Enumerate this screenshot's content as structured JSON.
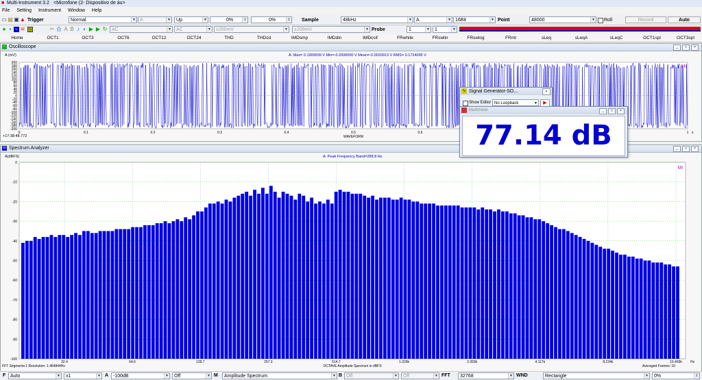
{
  "window": {
    "title": "Multi-Instrument 3.2",
    "device": "<Microfone (2- Dispositivo de áu>"
  },
  "menu": [
    "File",
    "Setting",
    "Instrument",
    "Window",
    "Help"
  ],
  "toolbar1": {
    "trigger_label": "Trigger",
    "trigger_mode": "Normal",
    "channel": "A",
    "edge": "Up",
    "level1": "0%",
    "level2": "0%",
    "sample_label": "Sample",
    "sample_rate": "48kHz",
    "chan2": "A",
    "bits": "16Bit",
    "point_label": "Point",
    "points": "48000",
    "roll_label": "Roll",
    "record_label": "Record",
    "auto_label": "Auto"
  },
  "toolbar2": {
    "coupling_a": "AC",
    "coupling_b": "AC",
    "range_a": "±200mV",
    "range_b": "±200mV",
    "probe_label": "Probe",
    "probe_a": "1",
    "probe_b": "1"
  },
  "tabs": [
    "Home",
    "OCT1",
    "OCT3",
    "OCT6",
    "OCT12",
    "OCT24",
    "THD",
    "THDcd",
    "IMDsmp",
    "IMDdin",
    "IMDccif",
    "FRwhite",
    "FRswlin",
    "FRswlog",
    "FRmt",
    "sLeq",
    "sLeqA",
    "sLeqC",
    "OCT1spl",
    "OCT3spl"
  ],
  "oscilloscope": {
    "title": "Oscilloscope",
    "unit_label": "A (mV)",
    "stats": "A: Max= 0.1999939 V  Min=-0.2000000 V  Mean=-0.0020913 V  RMS= 0.1724095 V",
    "y_ticks": [
      "200",
      "180",
      "160",
      "140",
      "120",
      "100",
      "80",
      "60",
      "40",
      "20",
      "0",
      "-20",
      "-40",
      "-60",
      "-80",
      "-100",
      "-120",
      "-140",
      "-160",
      "-180",
      "-200"
    ],
    "x_ticks": [
      "0",
      "0.1",
      "0.2",
      "0.3",
      "0.4",
      "0.5",
      "0.6",
      "0.7",
      "0.8",
      "0.9",
      "1"
    ],
    "x_unit": "s",
    "timestamp": "+17:38:48.772",
    "xlabel": "WAVEFORM",
    "marker": "Mi"
  },
  "siggen": {
    "title": "Signal Generator-SO...",
    "show_editor": "Show Editor",
    "loopback": "No Loopback"
  },
  "meter": {
    "title": "Multimeter",
    "value": "77.14 dB"
  },
  "spectrum": {
    "title": "Spectrum Analyzer",
    "unit_label": "A(dBFS)",
    "peak": "A: Peak Frequency Band=288.8 Hz",
    "marker": "Mi",
    "footer_left": "FFT  Segments:1    Resolution: 1.464844Hz",
    "footer_right": "Averaged Frames: 10",
    "xlabel": "OCTAVE Amplitude Spectrum in dBFS",
    "x_unit": "Hz"
  },
  "chart_data": {
    "type": "bar",
    "title": "",
    "xlabel": "OCTAVE Amplitude Spectrum in dBFS",
    "ylabel": "A(dBFS)",
    "ylim": [
      -100,
      0
    ],
    "y_ticks": [
      "0",
      "-10",
      "-20",
      "-30",
      "-40",
      "-50",
      "-60",
      "-70",
      "-80",
      "-90",
      "-100"
    ],
    "x_ticks": [
      "32.4",
      "64.6",
      "128.7",
      "257.3",
      "514.7",
      "1.029k",
      "2.059k",
      "4.117k",
      "8.234k",
      "16.469k"
    ],
    "values": [
      -41,
      -40,
      -40,
      -38,
      -39,
      -38,
      -38,
      -37,
      -38,
      -37,
      -37,
      -38,
      -37,
      -36,
      -37,
      -35,
      -35,
      -36,
      -36,
      -35,
      -35,
      -35,
      -35,
      -34,
      -34,
      -34,
      -34,
      -33,
      -33,
      -33,
      -32,
      -32,
      -32,
      -31,
      -31,
      -30,
      -31,
      -30,
      -29,
      -30,
      -28,
      -29,
      -27,
      -25,
      -25,
      -23,
      -21,
      -21,
      -20,
      -21,
      -19,
      -20,
      -18,
      -17,
      -16,
      -15,
      -17,
      -14,
      -16,
      -13,
      -16,
      -12,
      -15,
      -18,
      -15,
      -16,
      -17,
      -19,
      -16,
      -17,
      -20,
      -18,
      -21,
      -20,
      -21,
      -19,
      -21,
      -15,
      -14,
      -15,
      -15,
      -16,
      -16,
      -16,
      -17,
      -18,
      -17,
      -19,
      -18,
      -18,
      -18,
      -19,
      -19,
      -18,
      -19,
      -19,
      -20,
      -20,
      -21,
      -21,
      -21,
      -21,
      -22,
      -22,
      -22,
      -22,
      -22,
      -22,
      -23,
      -23,
      -23,
      -23,
      -24,
      -23,
      -24,
      -24,
      -25,
      -24,
      -25,
      -25,
      -26,
      -26,
      -27,
      -27,
      -28,
      -28,
      -29,
      -29,
      -30,
      -31,
      -32,
      -33,
      -34,
      -34,
      -35,
      -36,
      -37,
      -38,
      -39,
      -40,
      -41,
      -42,
      -43,
      -44,
      -44,
      -45,
      -46,
      -47,
      -47,
      -48,
      -48,
      -49,
      -49,
      -50,
      -50,
      -51,
      -51,
      -51,
      -52,
      -52,
      -53,
      -53
    ]
  },
  "bottombar": {
    "f_label": "F",
    "f_value": "Auto",
    "mult": "x1",
    "a_label": "A",
    "a_value": "-100dB",
    "off1": "Off",
    "m_label": "M",
    "m_value": "Amplitude Spectrum",
    "b_label": "B",
    "off2": "Off",
    "off3": "Off",
    "fft_label": "FFT",
    "fft_value": "32768",
    "wnd_label": "WND",
    "wnd_value": "Rectangle",
    "pct": "0%"
  }
}
